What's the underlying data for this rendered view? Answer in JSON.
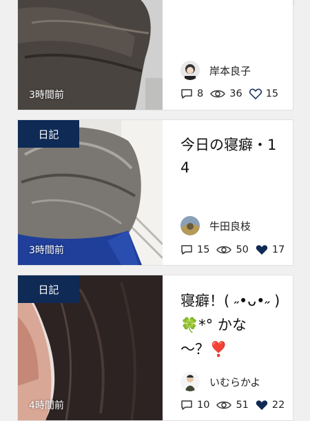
{
  "posts": [
    {
      "tag": "",
      "time": "3時間前",
      "title": "",
      "author": "岸本良子",
      "comments": "8",
      "views": "36",
      "likes": "15",
      "liked": false
    },
    {
      "tag": "日記",
      "time": "3時間前",
      "title": "今日の寝癖・14",
      "author": "牛田良枝",
      "comments": "15",
      "views": "50",
      "likes": "17",
      "liked": true
    },
    {
      "tag": "日記",
      "time": "4時間前",
      "title": "寝癖！( ˶•ᴗ•˶ )🍀*° かな～？❣️",
      "author": "いむらかよ",
      "comments": "10",
      "views": "51",
      "likes": "22",
      "liked": true
    }
  ],
  "colors": {
    "tag_bg": "#0e2a55",
    "heart": "#0e2a55"
  }
}
